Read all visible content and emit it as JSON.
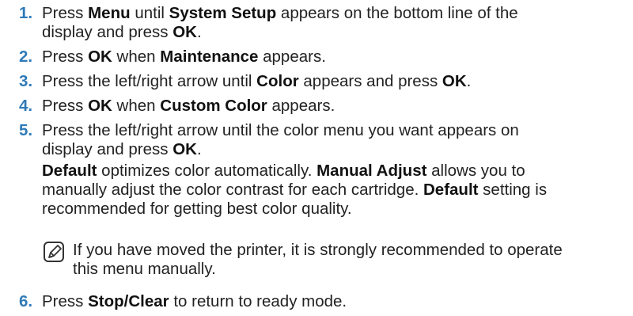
{
  "steps": [
    {
      "number": "1.",
      "parts": [
        {
          "t": "Press "
        },
        {
          "t": "Menu",
          "b": true
        },
        {
          "t": " until "
        },
        {
          "t": "System Setup",
          "b": true
        },
        {
          "t": " appears on the bottom line of the"
        }
      ],
      "line2": [
        {
          "t": "display and press "
        },
        {
          "t": "OK",
          "b": true
        },
        {
          "t": "."
        }
      ]
    },
    {
      "number": "2.",
      "parts": [
        {
          "t": "Press "
        },
        {
          "t": "OK",
          "b": true
        },
        {
          "t": " when "
        },
        {
          "t": "Maintenance",
          "b": true
        },
        {
          "t": " appears."
        }
      ]
    },
    {
      "number": "3.",
      "parts": [
        {
          "t": "Press the left/right arrow until "
        },
        {
          "t": "Color",
          "b": true
        },
        {
          "t": " appears and press "
        },
        {
          "t": "OK",
          "b": true
        },
        {
          "t": "."
        }
      ]
    },
    {
      "number": "4.",
      "parts": [
        {
          "t": "Press "
        },
        {
          "t": "OK",
          "b": true
        },
        {
          "t": " when "
        },
        {
          "t": "Custom Color",
          "b": true
        },
        {
          "t": " appears."
        }
      ]
    },
    {
      "number": "5.",
      "parts": [
        {
          "t": "Press the left/right arrow until the color menu you want appears on"
        }
      ],
      "line2": [
        {
          "t": "display and press "
        },
        {
          "t": "OK",
          "b": true
        },
        {
          "t": "."
        }
      ]
    }
  ],
  "explanation": {
    "line1": [
      {
        "t": "Default",
        "b": true
      },
      {
        "t": " optimizes color automatically. "
      },
      {
        "t": "Manual Adjust",
        "b": true
      },
      {
        "t": " allows you to"
      }
    ],
    "line2": [
      {
        "t": "manually adjust the color contrast for each cartridge. "
      },
      {
        "t": "Default",
        "b": true
      },
      {
        "t": " setting is"
      }
    ],
    "line3": [
      {
        "t": "recommended for getting best color quality."
      }
    ]
  },
  "note": {
    "icon": "note-pencil-icon",
    "line1": "If you have moved the printer, it is strongly recommended to operate",
    "line2": "this menu manually."
  },
  "step6": {
    "number": "6.",
    "parts": [
      {
        "t": "Press "
      },
      {
        "t": "Stop/Clear",
        "b": true
      },
      {
        "t": " to return to ready mode."
      }
    ]
  },
  "accent_color": "#2f7ab7"
}
